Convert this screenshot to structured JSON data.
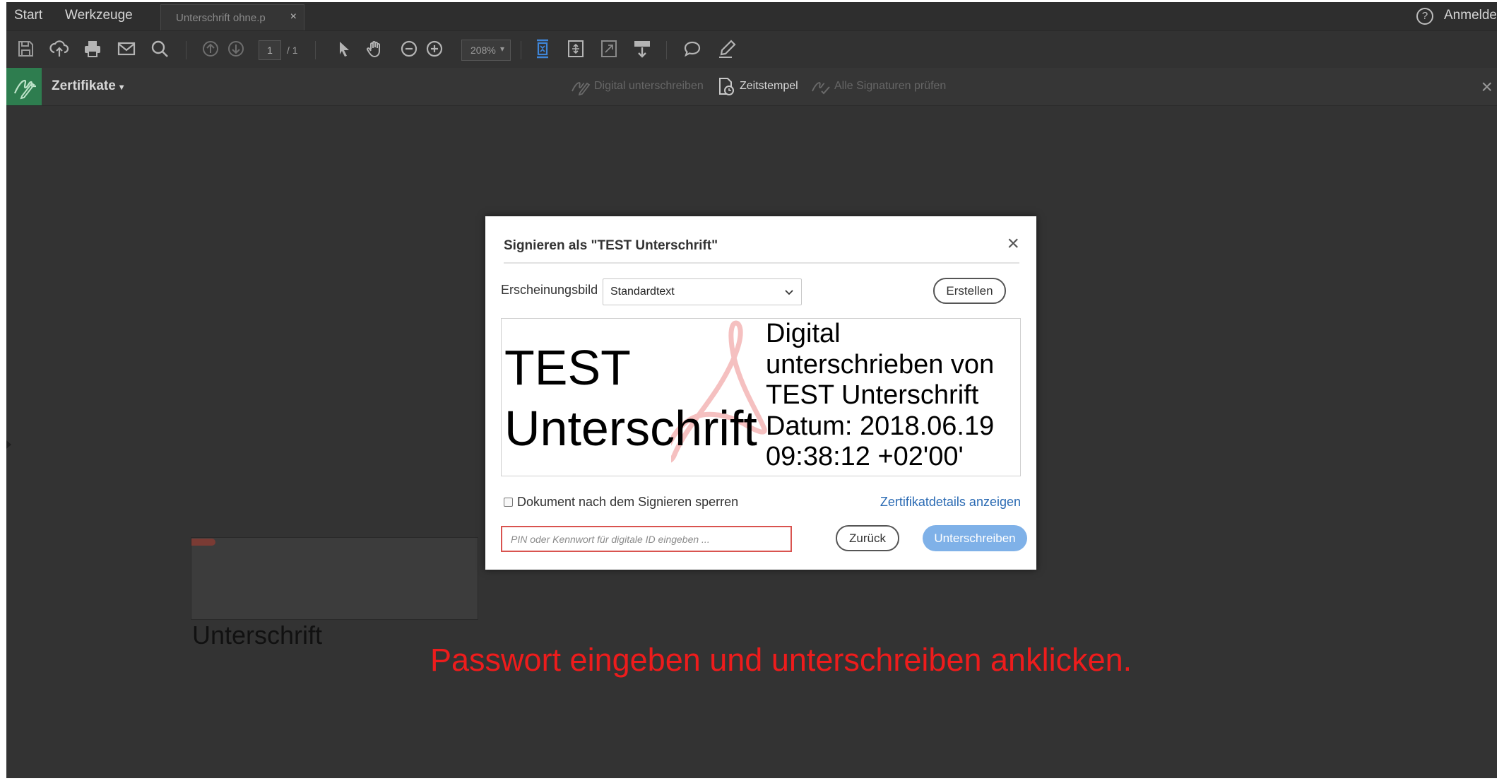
{
  "menubar": {
    "items": [
      "Start",
      "Werkzeuge"
    ],
    "tab_label": "Unterschrift ohne.p",
    "tab_close": "×",
    "help_glyph": "?",
    "sign_in": "Anmelde"
  },
  "toolbar": {
    "page_current": "1",
    "page_total": "/ 1",
    "zoom": "208%",
    "zoom_arrow": "▾",
    "icons": [
      "save-icon",
      "upload-icon",
      "print-icon",
      "email-icon",
      "search-icon",
      "page-up-icon",
      "page-down-icon",
      "select-arrow-icon",
      "hand-icon",
      "zoom-out-icon",
      "zoom-in-icon",
      "fit-page-icon",
      "scroll-mode-icon",
      "full-screen-icon",
      "page-down-arrow-icon",
      "comment-icon",
      "pen-icon"
    ]
  },
  "certbar": {
    "title": "Zertifikate",
    "actions": [
      "Digital unterschreiben",
      "Zeitstempel",
      "Alle Signaturen prüfen"
    ],
    "close": "×"
  },
  "document": {
    "signature_label": "Unterschrift",
    "instruction": "Passwort eingeben und unterschreiben anklicken."
  },
  "dialog": {
    "title": "Signieren als \"TEST Unterschrift\"",
    "close": "×",
    "appearance_label": "Erscheinungsbild",
    "appearance_value": "Standardtext",
    "create_button": "Erstellen",
    "preview": {
      "name_line1": "TEST",
      "name_line2": "Unterschrift",
      "details": "Digital\nunterschrieben von\nTEST Unterschrift\nDatum: 2018.06.19\n09:38:12 +02'00'"
    },
    "lock_label": "Dokument nach dem Signieren sperren",
    "cert_link": "Zertifikatdetails anzeigen",
    "pin_placeholder": "PIN oder Kennwort für digitale ID eingeben ...",
    "back_button": "Zurück",
    "sign_button": "Unterschreiben"
  },
  "colors": {
    "app_bg": "#333333",
    "accent_green": "#2e7d4f",
    "primary_button": "#7fb1e8",
    "link": "#2a6ab3",
    "instruction_red": "#ee1c1c",
    "input_error_border": "#d9534f"
  }
}
